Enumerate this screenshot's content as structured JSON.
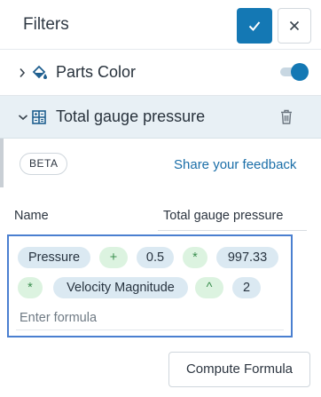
{
  "header": {
    "title": "Filters"
  },
  "parts_color": {
    "label": "Parts Color",
    "enabled": true
  },
  "filter": {
    "title": "Total gauge pressure",
    "badge": "BETA",
    "feedback_link": "Share your feedback",
    "name_label": "Name",
    "name_value": "Total gauge pressure",
    "formula_tokens": [
      {
        "text": "Pressure",
        "kind": "variable"
      },
      {
        "text": "+",
        "kind": "operator"
      },
      {
        "text": "0.5",
        "kind": "variable"
      },
      {
        "text": "*",
        "kind": "operator"
      },
      {
        "text": "997.33",
        "kind": "variable"
      },
      {
        "text": "*",
        "kind": "operator"
      },
      {
        "text": "Velocity Magnitude",
        "kind": "variable"
      },
      {
        "text": "^",
        "kind": "operator"
      },
      {
        "text": "2",
        "kind": "variable"
      }
    ],
    "formula_placeholder": "Enter formula",
    "compute_button": "Compute Formula"
  },
  "colors": {
    "accent": "#1478b4",
    "formula_border": "#4a7fd0",
    "variable_chip": "#dbe9f2",
    "operator_chip": "#dcf3e0"
  }
}
